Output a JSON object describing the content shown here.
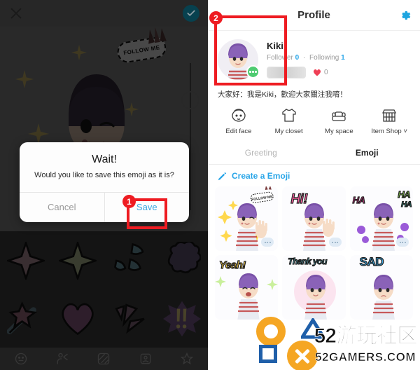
{
  "editor": {
    "close_icon": "close-icon",
    "confirm_icon": "check-circle-icon",
    "preview_sticker_text": "FOLLOW ME",
    "stickers": [
      {
        "name": "four-point-star-sticker"
      },
      {
        "name": "four-point-star-outline-sticker"
      },
      {
        "name": "teardrops-sticker"
      },
      {
        "name": "cloud-burst-sticker"
      },
      {
        "name": "shooting-star-sticker"
      },
      {
        "name": "heart-sticker"
      },
      {
        "name": "speed-lines-sticker"
      },
      {
        "name": "exclamation-burst-sticker"
      }
    ],
    "toolbar": [
      {
        "name": "face-icon"
      },
      {
        "name": "pose-icon"
      },
      {
        "name": "background-icon"
      },
      {
        "name": "frame-icon"
      },
      {
        "name": "sticker-star-icon"
      }
    ]
  },
  "dialog": {
    "title": "Wait!",
    "message": "Would you like to save this emoji as it is?",
    "cancel_label": "Cancel",
    "save_label": "Save"
  },
  "profile": {
    "header_title": "Profile",
    "settings_icon": "gear-icon",
    "user_name": "Kiki",
    "follower_label": "Follower",
    "follower_count": "0",
    "separator": "·",
    "following_label": "Following",
    "following_count": "1",
    "heart_count": "0",
    "bio": "大家好：我是Kiki，歡迎大家關注我唷！",
    "actions": [
      {
        "label": "Edit face",
        "icon": "face-outline-icon"
      },
      {
        "label": "My closet",
        "icon": "shirt-icon"
      },
      {
        "label": "My space",
        "icon": "sofa-icon"
      },
      {
        "label": "Item Shop ˅",
        "icon": "shop-icon"
      }
    ],
    "tabs": [
      {
        "label": "Greeting",
        "active": false
      },
      {
        "label": "Emoji",
        "active": true
      }
    ],
    "create_label": "Create a Emoji",
    "create_icon": "pencil-icon",
    "emoji_cards": [
      {
        "word": "",
        "word_color": "#ffffff",
        "selected": true
      },
      {
        "word": "Hi!",
        "word_color": "#ff5fa2",
        "selected": false
      },
      {
        "word": "HA HA",
        "word_color": "#8ddc4a",
        "selected": false
      },
      {
        "word": "Yeah!",
        "word_color": "#ffd23f",
        "selected": false
      },
      {
        "word": "Thank you",
        "word_color": "#6fd9e8",
        "selected": false
      },
      {
        "word": "SAD",
        "word_color": "#3aa7e0",
        "selected": false
      }
    ]
  },
  "annotations": [
    {
      "number": "1",
      "target": "save-button"
    },
    {
      "number": "2",
      "target": "first-emoji-card"
    }
  ],
  "watermark": {
    "text_cn": "52游玩社区",
    "text_en": "52GAMERS.COM"
  },
  "colors": {
    "accent_blue": "#2aa6e8",
    "annotation_red": "#ee1c22",
    "status_green": "#4ecb71",
    "heart_red": "#ef4056",
    "watermark_orange": "#f5a623",
    "watermark_blue": "#1f5fa9"
  }
}
